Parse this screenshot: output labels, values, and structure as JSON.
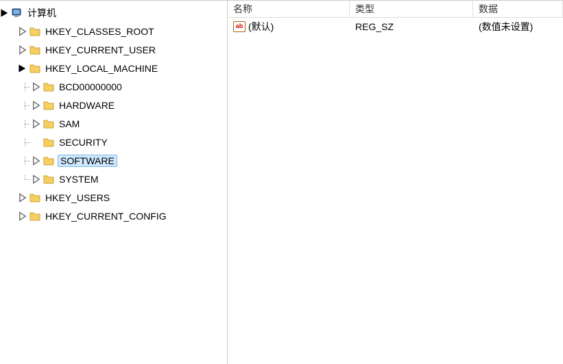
{
  "tree": {
    "root_label": "计算机",
    "nodes": {
      "hkcr": "HKEY_CLASSES_ROOT",
      "hkcu": "HKEY_CURRENT_USER",
      "hklm": "HKEY_LOCAL_MACHINE",
      "hku": "HKEY_USERS",
      "hkcc": "HKEY_CURRENT_CONFIG",
      "bcd": "BCD00000000",
      "hw": "HARDWARE",
      "sam": "SAM",
      "sec": "SECURITY",
      "sw": "SOFTWARE",
      "sys": "SYSTEM"
    }
  },
  "list": {
    "headers": {
      "name": "名称",
      "type": "类型",
      "data": "数据"
    },
    "rows": [
      {
        "name": "(默认)",
        "type": "REG_SZ",
        "data": "(数值未设置)"
      }
    ]
  },
  "icons": {
    "string_value_badge": "ab"
  }
}
